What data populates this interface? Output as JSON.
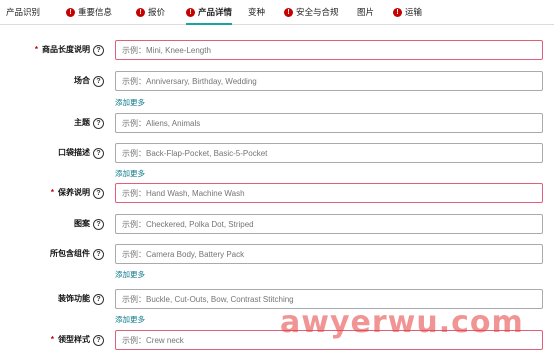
{
  "tabs": [
    {
      "label": "产品识别",
      "alert": false,
      "active": false
    },
    {
      "label": "重要信息",
      "alert": true,
      "active": false
    },
    {
      "label": "报价",
      "alert": true,
      "active": false
    },
    {
      "label": "产品详情",
      "alert": true,
      "active": true
    },
    {
      "label": "变种",
      "alert": false,
      "active": false
    },
    {
      "label": "安全与合规",
      "alert": true,
      "active": false
    },
    {
      "label": "图片",
      "alert": false,
      "active": false
    },
    {
      "label": "运输",
      "alert": true,
      "active": false
    }
  ],
  "alert_glyph": "!",
  "help_glyph": "?",
  "required_mark": "*",
  "add_more_label": "添加更多",
  "fields": [
    {
      "label": "商品长度说明",
      "required": true,
      "placeholder": "示例：Mini, Knee-Length",
      "add_more": false
    },
    {
      "label": "场合",
      "required": false,
      "placeholder": "示例：Anniversary, Birthday, Wedding",
      "add_more": true
    },
    {
      "label": "主题",
      "required": false,
      "placeholder": "示例：Aliens, Animals",
      "add_more": false
    },
    {
      "label": "口袋描述",
      "required": false,
      "placeholder": "示例：Back-Flap-Pocket, Basic-5-Pocket",
      "add_more": true
    },
    {
      "label": "保养说明",
      "required": true,
      "placeholder": "示例：Hand Wash, Machine Wash",
      "add_more": false
    },
    {
      "label": "图案",
      "required": false,
      "placeholder": "示例：Checkered, Polka Dot, Striped",
      "add_more": false
    },
    {
      "label": "所包含组件",
      "required": false,
      "placeholder": "示例：Camera Body, Battery Pack",
      "add_more": true
    },
    {
      "label": "装饰功能",
      "required": false,
      "placeholder": "示例：Buckle, Cut-Outs, Bow, Contrast Stitching",
      "add_more": true
    },
    {
      "label": "领型样式",
      "required": true,
      "placeholder": "示例：Crew neck",
      "add_more": false
    }
  ],
  "watermark": "awyerwu.com"
}
